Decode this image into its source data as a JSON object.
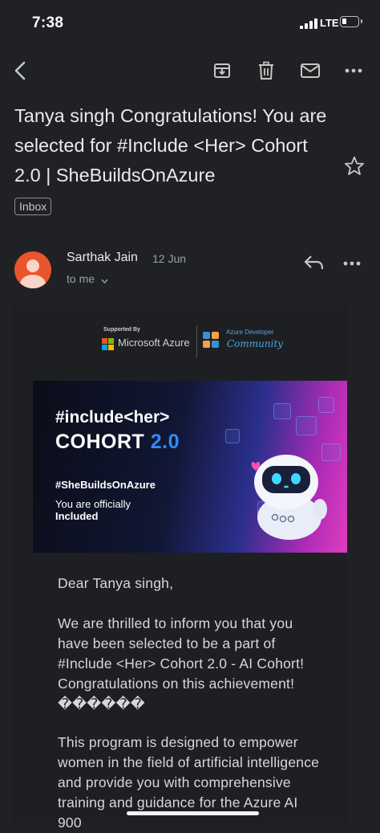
{
  "status_bar": {
    "time": "7:38",
    "network": "LTE"
  },
  "toolbar": {
    "back": "back-arrow-icon",
    "actions": [
      "archive-icon",
      "delete-icon",
      "mark-unread-icon",
      "more-icon"
    ]
  },
  "email": {
    "subject": "Tanya singh Congratulations! You are selected for #Include <Her> Cohort 2.0 | SheBuildsOnAzure",
    "label": "Inbox",
    "sender": "Sarthak Jain",
    "date": "12 Jun",
    "recipient": "to me"
  },
  "banner": {
    "supported_by": "Supported By",
    "microsoft": "Microsoft Azure",
    "adc_title": "Azure Developer",
    "adc_sub": "Community",
    "include": "#include<her>",
    "cohort": "COHORT",
    "version": "2.0",
    "hashtag": "#SheBuildsOnAzure",
    "officially": "You are officially",
    "included": "Included"
  },
  "body": {
    "greeting": "Dear Tanya singh,",
    "para1": "We are thrilled to inform you that you have been selected to be a part of #Include <Her> Cohort 2.0 - AI Cohort! Congratulations on this achievement! ������",
    "para2": "This program is designed to empower women in the field of artificial intelligence and provide you with comprehensive training and guidance for the Azure AI 900"
  },
  "colors": {
    "background": "#202124",
    "avatar": "#e8552c",
    "accent_blue": "#2f8cff"
  }
}
